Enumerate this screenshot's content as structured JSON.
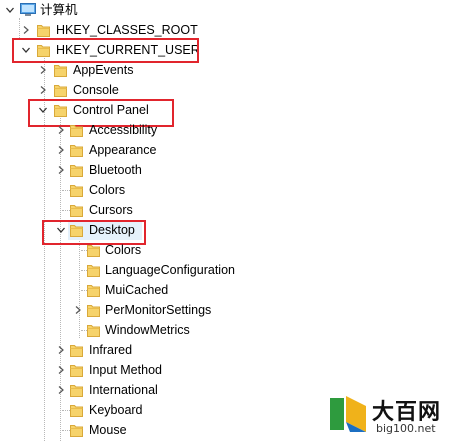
{
  "tree": {
    "root": "计算机",
    "hkcr": "HKEY_CLASSES_ROOT",
    "hkcu": "HKEY_CURRENT_USER",
    "appevents": "AppEvents",
    "console": "Console",
    "control_panel": "Control Panel",
    "accessibility": "Accessibility",
    "appearance": "Appearance",
    "bluetooth": "Bluetooth",
    "colors": "Colors",
    "cursors": "Cursors",
    "desktop": "Desktop",
    "desktop_colors": "Colors",
    "language_configuration": "LanguageConfiguration",
    "muicached": "MuiCached",
    "per_monitor_settings": "PerMonitorSettings",
    "window_metrics": "WindowMetrics",
    "infrared": "Infrared",
    "input_method": "Input Method",
    "international": "International",
    "keyboard": "Keyboard",
    "mouse": "Mouse"
  },
  "watermark": {
    "title": "大百网",
    "url": "big100.net"
  },
  "colors": {
    "highlight_box": "#e1252d",
    "folder": "#f6d36b",
    "selection": "#e5f1fb"
  }
}
